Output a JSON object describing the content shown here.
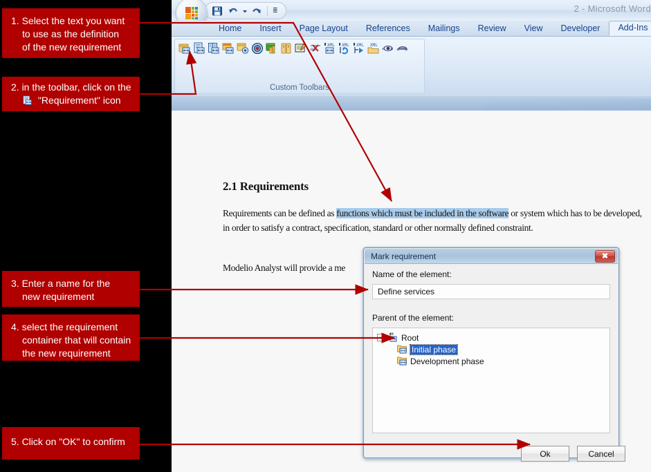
{
  "app": {
    "window_title": "2 - Microsoft Word",
    "quick_access": [
      {
        "name": "save-icon",
        "label": "Save"
      },
      {
        "name": "undo-icon",
        "label": "Undo"
      },
      {
        "name": "undo-dropdown-icon",
        "label": "Undo options"
      },
      {
        "name": "redo-icon",
        "label": "Redo"
      },
      {
        "name": "customize-qat-icon",
        "label": "Customize Quick Access Toolbar"
      }
    ],
    "office_button": "Office Button"
  },
  "ribbon": {
    "tabs": [
      {
        "label": "Home",
        "active": false
      },
      {
        "label": "Insert",
        "active": false
      },
      {
        "label": "Page Layout",
        "active": false
      },
      {
        "label": "References",
        "active": false
      },
      {
        "label": "Mailings",
        "active": false
      },
      {
        "label": "Review",
        "active": false
      },
      {
        "label": "View",
        "active": false
      },
      {
        "label": "Developer",
        "active": false
      },
      {
        "label": "Add-Ins",
        "active": true
      }
    ],
    "group_label": "Custom Toolbars",
    "toolbar_icons": [
      "new-document-requirement-icon",
      "requirement-icon",
      "mark-term-icon",
      "mark-element-icon",
      "link-element-icon",
      "target-icon",
      "business-rule-icon",
      "dictionary-icon",
      "note-icon",
      "unmark-icon",
      "xml-export-icon",
      "xml-sync-icon",
      "xml-generate-icon",
      "xml-folder-icon",
      "show-marks-icon",
      "hide-marks-icon"
    ]
  },
  "document": {
    "heading": "2.1 Requirements",
    "paragraph1_before": "Requirements can be defined as ",
    "paragraph1_highlight": "functions which must be included in the software",
    "paragraph1_after": " or system which has to be developed, in order to satisfy a contract, specification, standard or other normally defined constraint.",
    "paragraph2": "Modelio Analyst will provide a me"
  },
  "dialog": {
    "title": "Mark requirement",
    "close_label": "✖",
    "name_label": "Name of the element:",
    "name_value": "Define services",
    "parent_label": "Parent of the element:",
    "tree": [
      {
        "label": "Root",
        "level": 1,
        "expander": "−",
        "icon": "root-requirement-icon",
        "selected": false
      },
      {
        "label": "Initial phase",
        "level": 2,
        "expander": "",
        "icon": "requirement-folder-icon",
        "selected": true
      },
      {
        "label": "Development phase",
        "level": 2,
        "expander": "",
        "icon": "requirement-folder-icon",
        "selected": false
      }
    ],
    "ok_label": "Ok",
    "cancel_label": "Cancel"
  },
  "annotations": {
    "accent_color": "#b00000",
    "notes": [
      {
        "id": "note-1",
        "lines": [
          "1. Select the text you want",
          "to use as the definition",
          "of the new requirement"
        ]
      },
      {
        "id": "note-2",
        "lines": [
          "2. in the toolbar, click on the",
          "\"Requirement\" icon"
        ]
      },
      {
        "id": "note-3",
        "lines": [
          "3. Enter a name for the",
          "new requirement"
        ]
      },
      {
        "id": "note-4",
        "lines": [
          "4. select the requirement",
          "container that will contain",
          "the new requirement"
        ]
      },
      {
        "id": "note-5",
        "lines": [
          "5. Click on \"OK\" to confirm"
        ]
      }
    ]
  }
}
